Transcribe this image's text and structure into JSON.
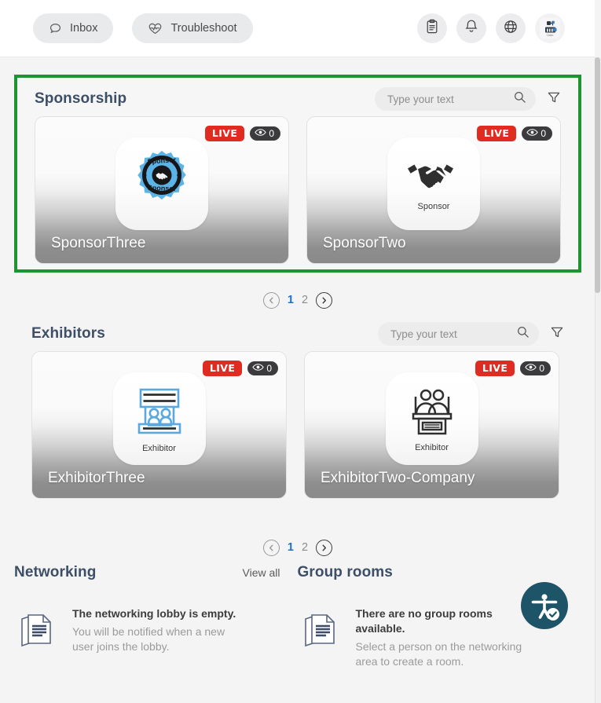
{
  "topbar": {
    "inbox_label": "Inbox",
    "troubleshoot_label": "Troubleshoot",
    "icons": [
      "clipboard-icon",
      "bell-icon",
      "globe-icon",
      "avatar"
    ]
  },
  "sponsorship": {
    "title": "Sponsorship",
    "search_placeholder": "Type your text",
    "search_value": "",
    "cards": [
      {
        "name": "SponsorThree",
        "live": "LIVE",
        "views": "0",
        "logo_caption": "",
        "logo_type": "sponsor-badge-blue"
      },
      {
        "name": "SponsorTwo",
        "live": "LIVE",
        "views": "0",
        "logo_caption": "Sponsor",
        "logo_type": "handshake-black"
      }
    ],
    "pagination": {
      "pages": [
        "1",
        "2"
      ],
      "active": "1"
    }
  },
  "exhibitors": {
    "title": "Exhibitors",
    "search_placeholder": "Type your text",
    "search_value": "",
    "cards": [
      {
        "name": "ExhibitorThree",
        "live": "LIVE",
        "views": "0",
        "logo_caption": "Exhibitor",
        "logo_type": "booth-blue"
      },
      {
        "name": "ExhibitorTwo-Company",
        "live": "LIVE",
        "views": "0",
        "logo_caption": "Exhibitor",
        "logo_type": "booth-dark"
      }
    ],
    "pagination": {
      "pages": [
        "1",
        "2"
      ],
      "active": "1"
    }
  },
  "networking": {
    "title": "Networking",
    "view_all": "View all",
    "empty_title": "The networking lobby is empty.",
    "empty_body": "You will be notified when a new user joins the lobby."
  },
  "group_rooms": {
    "title": "Group rooms",
    "empty_title": "There are no group rooms available.",
    "empty_body": "Select a person on the networking area to create a room."
  },
  "accessibility": {
    "label": "accessibility-button"
  },
  "colors": {
    "highlight_border": "#1e9431",
    "live_badge": "#e02b20",
    "views_badge": "#3b3b3d",
    "title": "#3d4f67",
    "active_page": "#1d6fd0",
    "a11y_fab": "#1e5468",
    "sponsor_blue": "#5bb4e5",
    "exhibitor_blue": "#5aa8dd"
  }
}
